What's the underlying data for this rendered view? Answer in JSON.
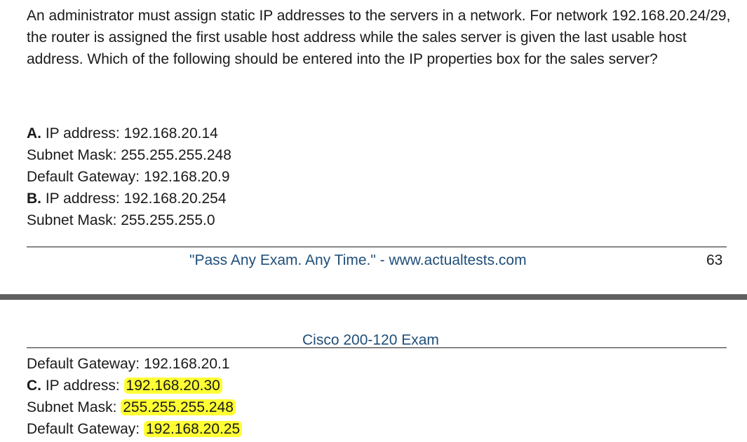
{
  "question": {
    "text": "An administrator must assign static IP addresses to the servers in a network. For network 192.168.20.24/29, the router is assigned the first usable host address while the sales server is given the last usable host address. Which of the following should be entered into the IP properties box for the sales server?"
  },
  "options_page1": [
    {
      "letter": "A.",
      "label": "IP address:",
      "value": "192.168.20.14"
    },
    {
      "label": "Subnet Mask:",
      "value": "255.255.255.248"
    },
    {
      "label": "Default Gateway:",
      "value": "192.168.20.9"
    },
    {
      "letter": "B.",
      "label": "IP address:",
      "value": "192.168.20.254"
    },
    {
      "label": "Subnet Mask:",
      "value": "255.255.255.0"
    }
  ],
  "footer": {
    "tagline": "\"Pass Any Exam. Any Time.\" - www.actualtests.com",
    "page_number": "63"
  },
  "header": {
    "title": "Cisco 200-120 Exam"
  },
  "options_page2": [
    {
      "label": "Default Gateway:",
      "value": "192.168.20.1"
    },
    {
      "letter": "C.",
      "label": "IP address:",
      "value": "192.168.20.30"
    },
    {
      "label": "Subnet Mask:",
      "value": "255.255.255.248"
    },
    {
      "label": "Default Gateway:",
      "value": "192.168.20.25"
    }
  ],
  "colors": {
    "highlight": "#ffff33",
    "footer_text": "#1f4e79",
    "page_break": "#5f5f5f"
  }
}
